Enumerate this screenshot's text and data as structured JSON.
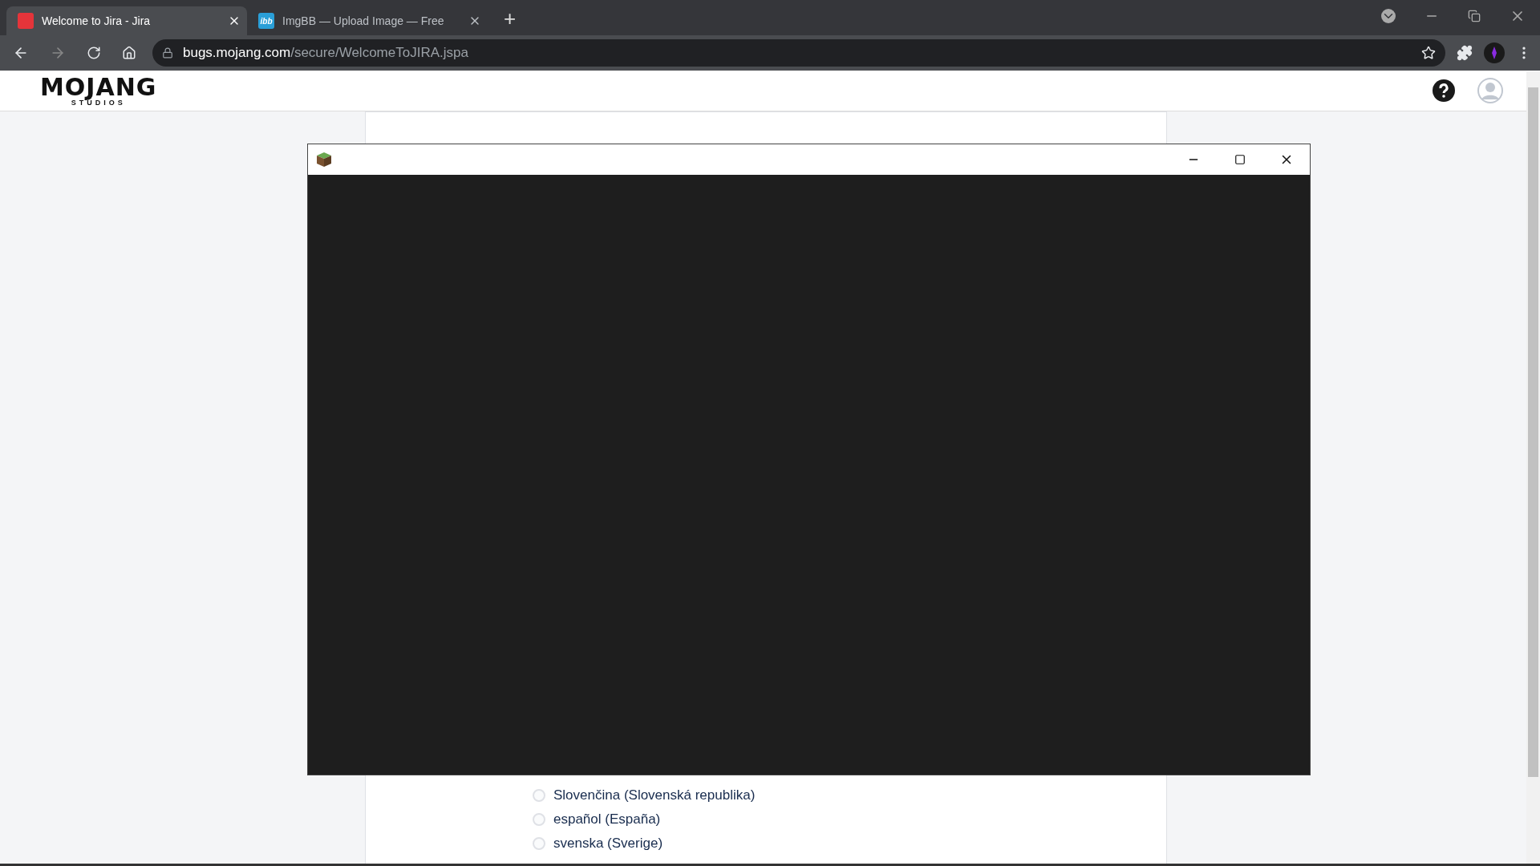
{
  "browser": {
    "tabs": [
      {
        "title": "Welcome to Jira - Jira",
        "selected": true
      },
      {
        "title": "ImgBB — Upload Image — Free",
        "selected": false,
        "icon_text": "ibb"
      }
    ],
    "new_tab": "+",
    "url_host": "bugs.mojang.com",
    "url_path": "/secure/WelcomeToJIRA.jspa"
  },
  "header": {
    "logo": "MOJANG",
    "logo_sub": "STUDIOS"
  },
  "languages": [
    {
      "label": "Slovenčina (Slovenská republika)",
      "selected": false
    },
    {
      "label": "español (España)",
      "selected": false
    },
    {
      "label": "svenska (Sverige)",
      "selected": false
    }
  ]
}
